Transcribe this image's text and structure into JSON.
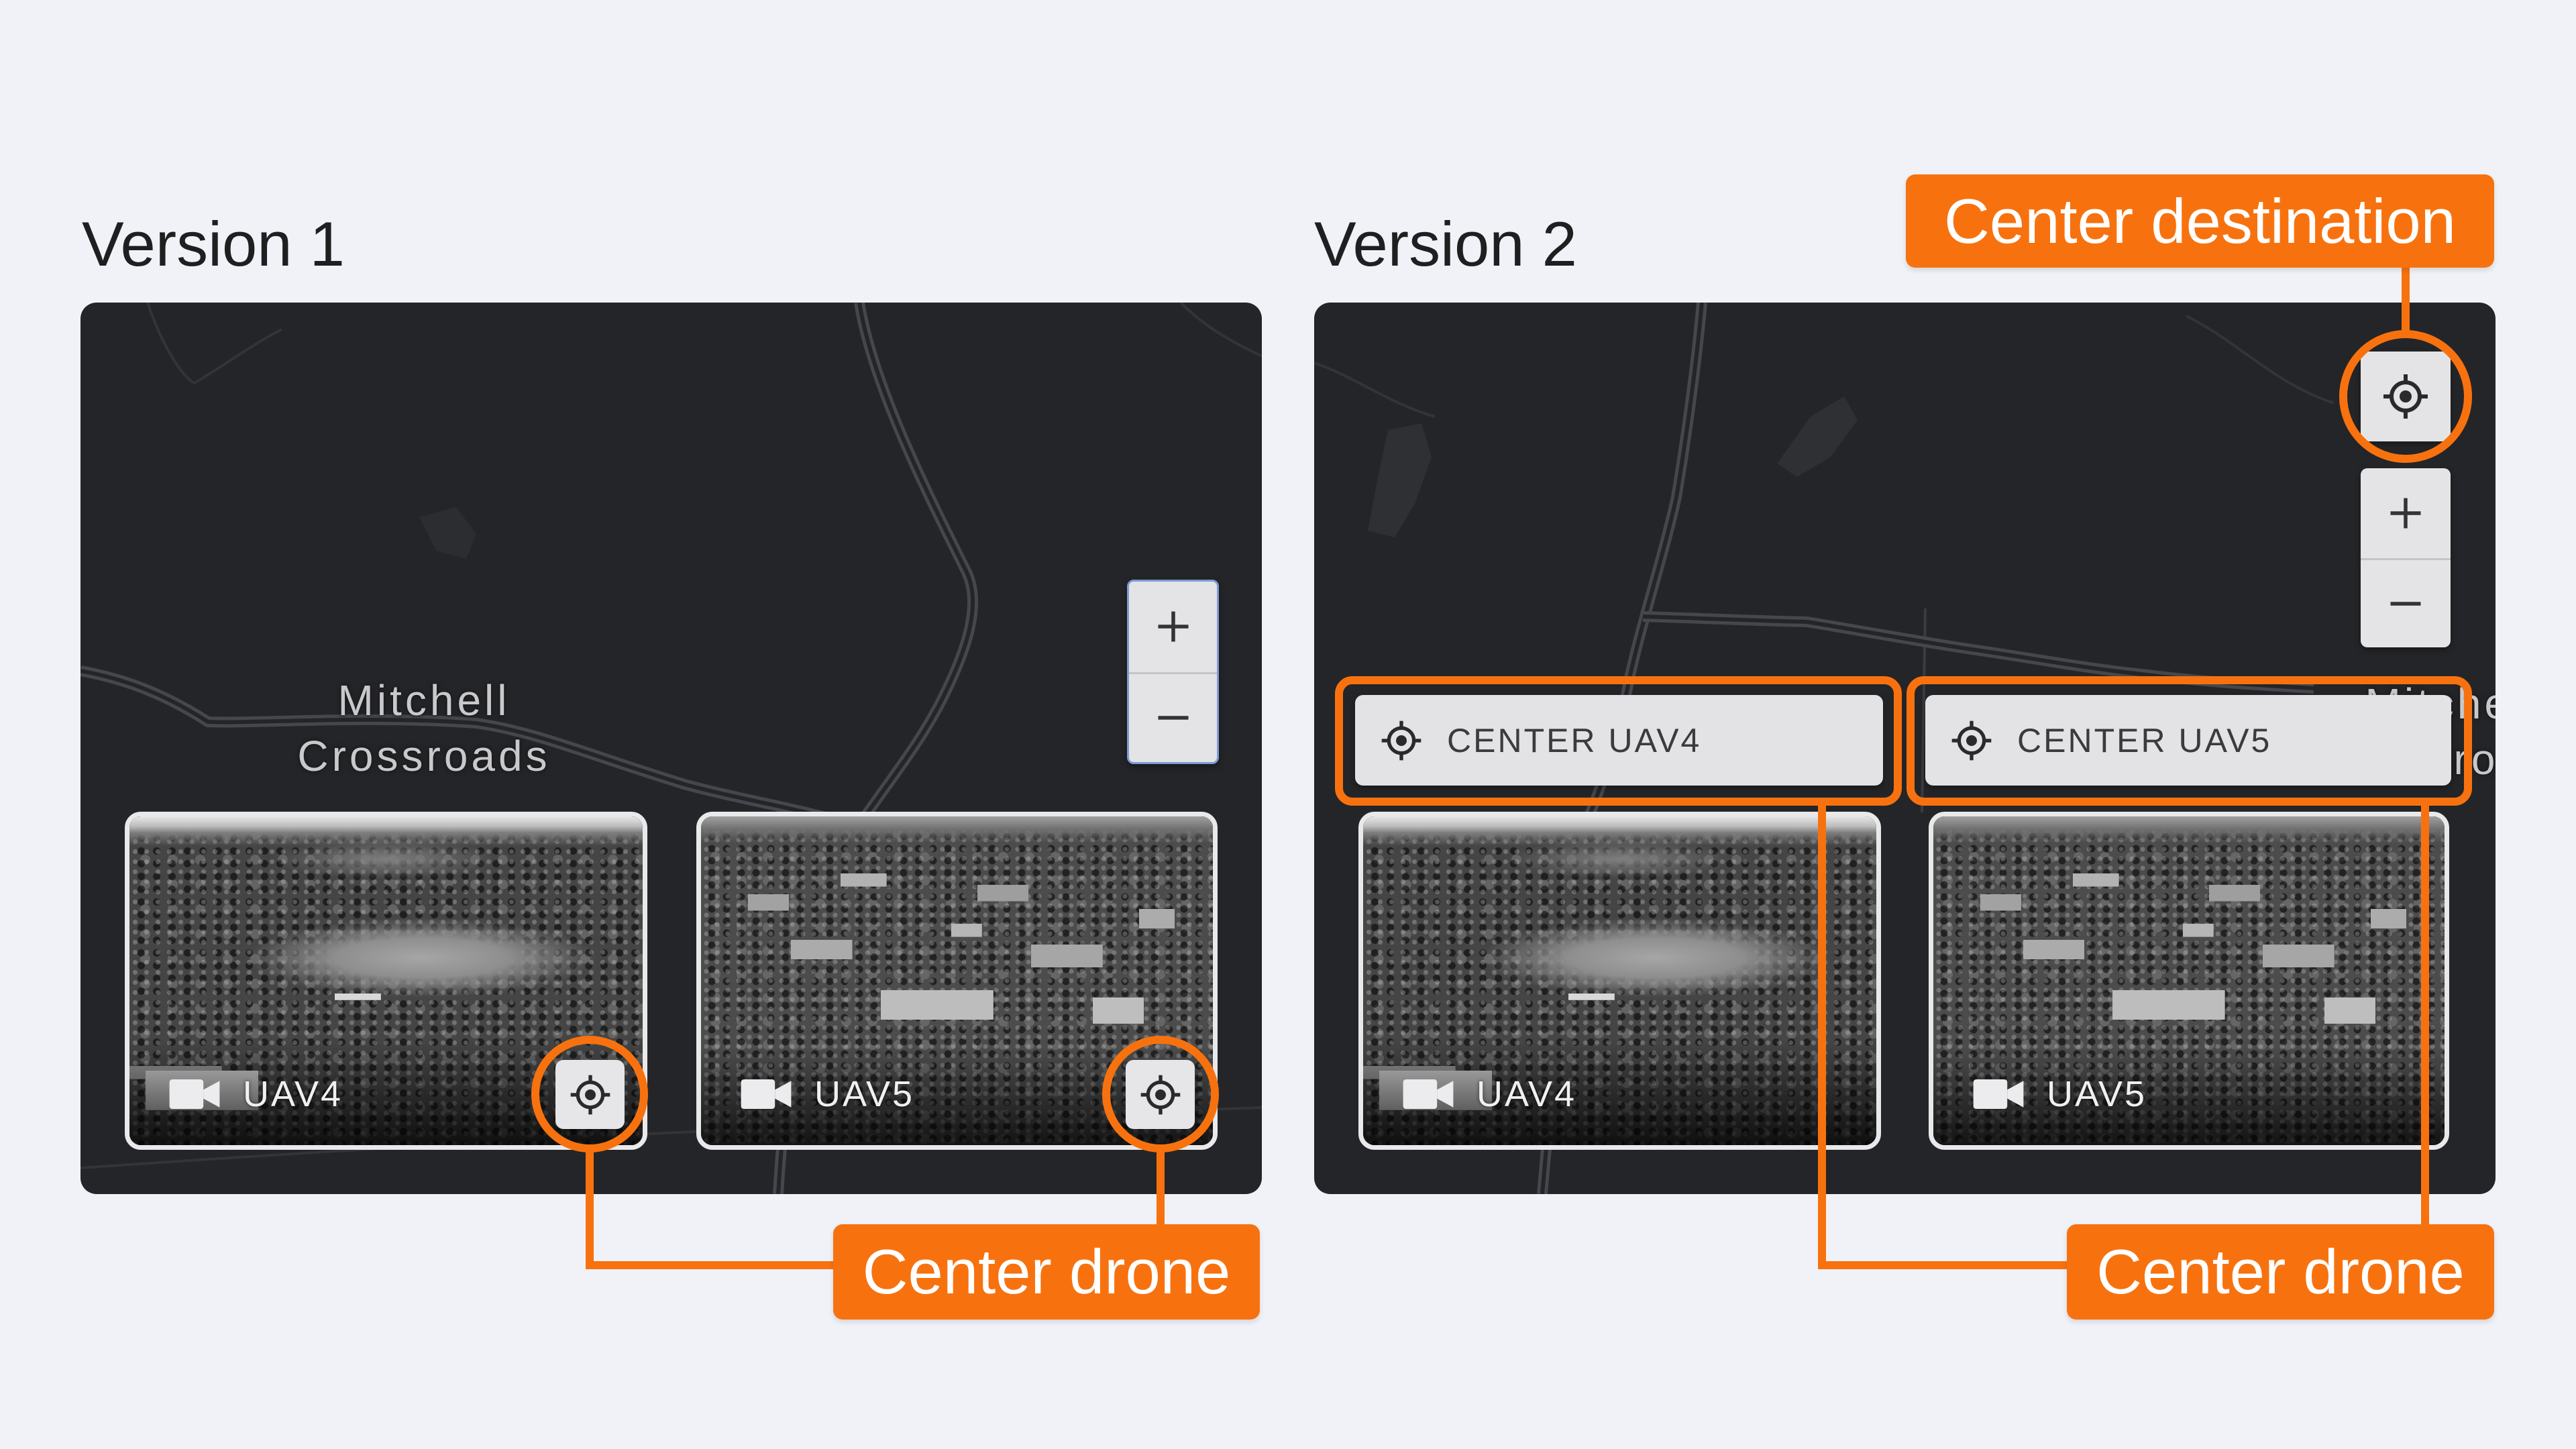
{
  "page": {
    "background": "#f1f2f7"
  },
  "colors": {
    "accent": "#f7720f",
    "map_background": "#242528",
    "control_background": "#e4e4e6",
    "selected_outline": "#7e9bd3"
  },
  "icons": {
    "center": "crosshair-target-icon",
    "camera": "video-camera-icon",
    "zoom_in": "plus-icon",
    "zoom_out": "minus-icon"
  },
  "version1": {
    "title": "Version 1",
    "map": {
      "place_label": [
        "Mitchell",
        "Crossroads"
      ]
    },
    "zoom": {
      "in_icon": "plus-icon",
      "out_icon": "minus-icon"
    },
    "feeds": [
      {
        "label": "UAV4",
        "camera_icon": "video-camera-icon",
        "center_icon": "crosshair-target-icon"
      },
      {
        "label": "UAV5",
        "camera_icon": "video-camera-icon",
        "center_icon": "crosshair-target-icon"
      }
    ],
    "callout": {
      "label": "Center drone"
    }
  },
  "version2": {
    "title": "Version 2",
    "map": {
      "place_label": [
        "Mitchell",
        "Crossroads"
      ]
    },
    "center_destination": {
      "icon": "crosshair-target-icon"
    },
    "zoom": {
      "in_icon": "plus-icon",
      "out_icon": "minus-icon"
    },
    "center_buttons": [
      {
        "label": "CENTER UAV4",
        "icon": "crosshair-target-icon"
      },
      {
        "label": "CENTER UAV5",
        "icon": "crosshair-target-icon"
      }
    ],
    "feeds": [
      {
        "label": "UAV4",
        "camera_icon": "video-camera-icon"
      },
      {
        "label": "UAV5",
        "camera_icon": "video-camera-icon"
      }
    ],
    "callouts": {
      "center_destination": "Center destination",
      "center_drone": "Center drone"
    }
  }
}
